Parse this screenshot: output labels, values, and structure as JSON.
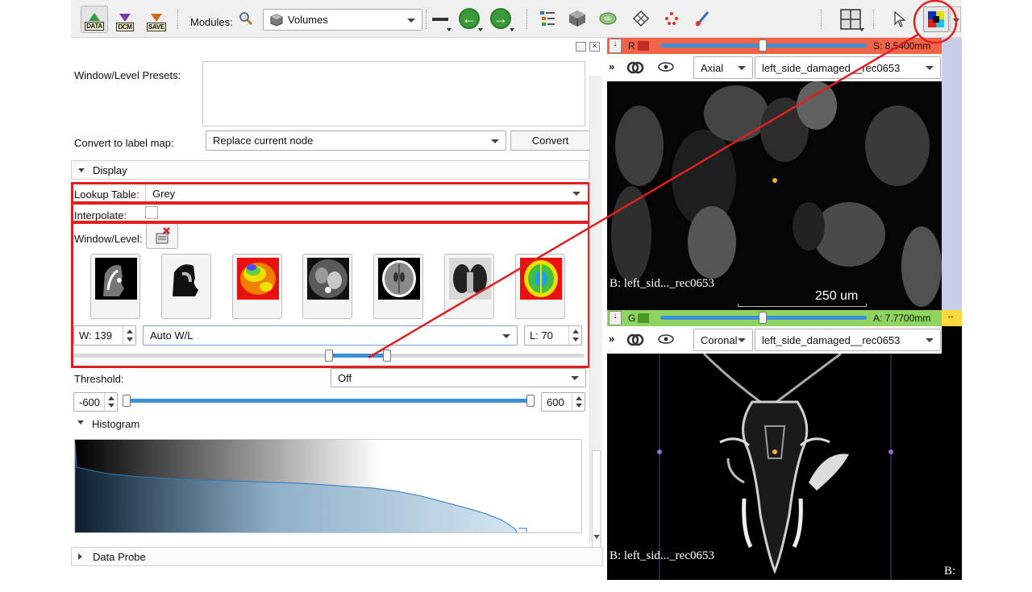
{
  "toolbar": {
    "data_label": "DATA",
    "dcm_label": "DCM",
    "save_label": "SAVE",
    "modules_label": "Modules:",
    "module_selected": "Volumes"
  },
  "panel": {
    "presets_label": "Window/Level Presets:",
    "convert_label": "Convert to label map:",
    "convert_option": "Replace current node",
    "convert_button": "Convert",
    "display_section": "Display",
    "lookup_label": "Lookup Table:",
    "lookup_value": "Grey",
    "interpolate_label": "Interpolate:",
    "wl_label": "Window/Level:",
    "window_value": "W: 139",
    "wl_mode": "Auto W/L",
    "level_value": "L: 70",
    "threshold_label": "Threshold:",
    "threshold_mode": "Off",
    "threshold_min": "-600",
    "threshold_max": "600",
    "histogram_section": "Histogram",
    "data_probe_section": "Data Probe"
  },
  "red_view": {
    "letter": "R",
    "offset": "S: 8.5400mm",
    "orientation": "Axial",
    "volume": "left_side_damaged__rec0653",
    "overlay_bg": "B: left_sid..._rec0653",
    "scale": "250 um",
    "color": "#f26448"
  },
  "green_view": {
    "letter": "G",
    "offset": "A: 7.7700mm",
    "orientation": "Coronal",
    "volume": "left_side_damaged__rec0653",
    "overlay_bg": "B: left_sid..._rec0653",
    "overlay_bg_right": "B: l",
    "color": "#8fd45e"
  },
  "yellow_view": {
    "color": "#ffd83a"
  },
  "annotation_color": "#e02020"
}
